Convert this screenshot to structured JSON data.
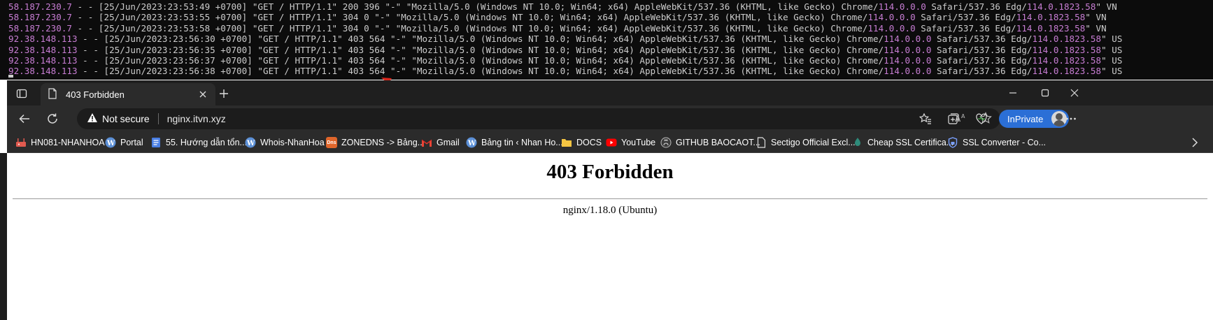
{
  "terminal": {
    "lines": [
      {
        "ip": "58.187.230.7",
        "date": "[25/Jun/2023:23:53:49 +0700]",
        "request": "\"GET / HTTP/1.1\"",
        "status": "200",
        "size": "396",
        "referer": "\"-\"",
        "ua_pre": "\"Mozilla/5.0 (Windows NT 10.0; Win64; x64) AppleWebKit/537.36 (KHTML, like Gecko) Chrome/",
        "chrome_ver": "114.0.0.0",
        "ua_mid": " Safari/537.36 Edg/",
        "edg_ver": "114.0.1823.58",
        "ua_end": "\"",
        "country": "VN"
      },
      {
        "ip": "58.187.230.7",
        "date": "[25/Jun/2023:23:53:55 +0700]",
        "request": "\"GET / HTTP/1.1\"",
        "status": "304",
        "size": "0",
        "referer": "\"-\"",
        "ua_pre": "\"Mozilla/5.0 (Windows NT 10.0; Win64; x64) AppleWebKit/537.36 (KHTML, like Gecko) Chrome/",
        "chrome_ver": "114.0.0.0",
        "ua_mid": " Safari/537.36 Edg/",
        "edg_ver": "114.0.1823.58",
        "ua_end": "\"",
        "country": "VN"
      },
      {
        "ip": "58.187.230.7",
        "date": "[25/Jun/2023:23:53:58 +0700]",
        "request": "\"GET / HTTP/1.1\"",
        "status": "304",
        "size": "0",
        "referer": "\"-\"",
        "ua_pre": "\"Mozilla/5.0 (Windows NT 10.0; Win64; x64) AppleWebKit/537.36 (KHTML, like Gecko) Chrome/",
        "chrome_ver": "114.0.0.0",
        "ua_mid": " Safari/537.36 Edg/",
        "edg_ver": "114.0.1823.58",
        "ua_end": "\"",
        "country": "VN"
      },
      {
        "ip": "92.38.148.113",
        "date": "[25/Jun/2023:23:56:30 +0700]",
        "request": "\"GET / HTTP/1.1\"",
        "status": "403",
        "size": "564",
        "referer": "\"-\"",
        "ua_pre": "\"Mozilla/5.0 (Windows NT 10.0; Win64; x64) AppleWebKit/537.36 (KHTML, like Gecko) Chrome/",
        "chrome_ver": "114.0.0.0",
        "ua_mid": " Safari/537.36 Edg/",
        "edg_ver": "114.0.1823.58",
        "ua_end": "\"",
        "country": "US"
      },
      {
        "ip": "92.38.148.113",
        "date": "[25/Jun/2023:23:56:35 +0700]",
        "request": "\"GET / HTTP/1.1\"",
        "status": "403",
        "size": "564",
        "referer": "\"-\"",
        "ua_pre": "\"Mozilla/5.0 (Windows NT 10.0; Win64; x64) AppleWebKit/537.36 (KHTML, like Gecko) Chrome/",
        "chrome_ver": "114.0.0.0",
        "ua_mid": " Safari/537.36 Edg/",
        "edg_ver": "114.0.1823.58",
        "ua_end": "\"",
        "country": "US"
      },
      {
        "ip": "92.38.148.113",
        "date": "[25/Jun/2023:23:56:37 +0700]",
        "request": "\"GET / HTTP/1.1\"",
        "status": "403",
        "size": "564",
        "referer": "\"-\"",
        "ua_pre": "\"Mozilla/5.0 (Windows NT 10.0; Win64; x64) AppleWebKit/537.36 (KHTML, like Gecko) Chrome/",
        "chrome_ver": "114.0.0.0",
        "ua_mid": " Safari/537.36 Edg/",
        "edg_ver": "114.0.1823.58",
        "ua_end": "\"",
        "country": "US"
      },
      {
        "ip": "92.38.148.113",
        "date": "[25/Jun/2023:23:56:38 +0700]",
        "request": "\"GET / HTTP/1.1\"",
        "status": "403",
        "size": "564",
        "referer": "\"-\"",
        "ua_pre": "\"Mozilla/5.0 (Windows NT 10.0; Win64; x64) AppleWebKit/537.36 (KHTML, like Gecko) Chrome/",
        "chrome_ver": "114.0.0.0",
        "ua_mid": " Safari/537.36 Edg/",
        "edg_ver": "114.0.1823.58",
        "ua_end": "\"",
        "country": "US"
      }
    ],
    "highlight_color": "#c77dd3",
    "annotation_color": "#d9271d"
  },
  "browser": {
    "tab": {
      "title": "403 Forbidden"
    },
    "address": {
      "security_label": "Not secure",
      "url": "nginx.itvn.xyz"
    },
    "inprivate_label": "InPrivate",
    "bookmarks": [
      {
        "label": "HN081-NHANHOA",
        "icon": "router-icon"
      },
      {
        "label": "Portal",
        "icon": "wordpress-icon"
      },
      {
        "label": "55. Hướng dẫn tổn...",
        "icon": "docs-icon"
      },
      {
        "label": "Whois-NhanHoa",
        "icon": "wordpress-icon"
      },
      {
        "label": "ZONEDNS -> Bảng...",
        "icon": "dns-icon"
      },
      {
        "label": "Gmail",
        "icon": "gmail-icon"
      },
      {
        "label": "Bảng tin ‹ Nhan Ho...",
        "icon": "wordpress-icon"
      },
      {
        "label": "DOCS",
        "icon": "folder-icon"
      },
      {
        "label": "YouTube",
        "icon": "youtube-icon"
      },
      {
        "label": "GITHUB BAOCAOT...",
        "icon": "github-icon"
      },
      {
        "label": "Sectigo Official Excl...",
        "icon": "page-icon"
      },
      {
        "label": "Cheap SSL Certifica...",
        "icon": "ssl-icon"
      },
      {
        "label": "SSL Converter - Co...",
        "icon": "shield-icon"
      }
    ],
    "dns_icon_text": "Dns"
  },
  "page": {
    "heading": "403 Forbidden",
    "server": "nginx/1.18.0 (Ubuntu)"
  },
  "colors": {
    "tabbar": "#1f1f1f",
    "toolbar": "#2b2b2b",
    "accent": "#2b6fd6"
  }
}
